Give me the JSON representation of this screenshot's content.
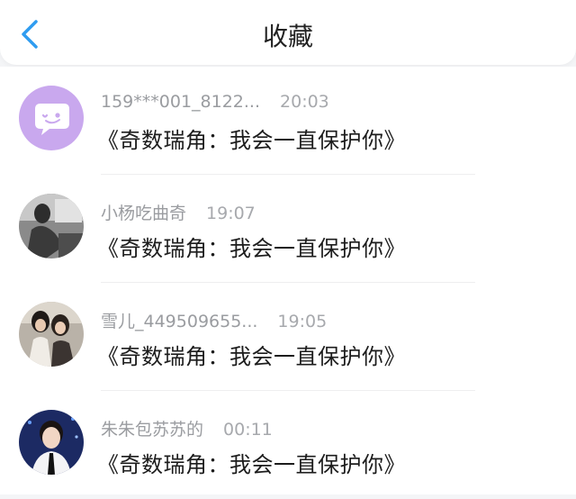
{
  "header": {
    "title": "收藏",
    "back_icon": "chevron-left-icon",
    "accent_color": "#2f9cf0"
  },
  "items": [
    {
      "username": "159***001_8122...",
      "time": "20:03",
      "message": "《奇数瑞角：我会一直保护你》",
      "avatar": "default-chat-avatar-icon"
    },
    {
      "username": "小杨吃曲奇",
      "time": "19:07",
      "message": "《奇数瑞角：我会一直保护你》",
      "avatar": "user-photo"
    },
    {
      "username": "雪儿_449509655...",
      "time": "19:05",
      "message": "《奇数瑞角：我会一直保护你》",
      "avatar": "user-photo"
    },
    {
      "username": "朱朱包苏苏的",
      "time": "00:11",
      "message": "《奇数瑞角：我会一直保护你》",
      "avatar": "user-photo"
    }
  ]
}
